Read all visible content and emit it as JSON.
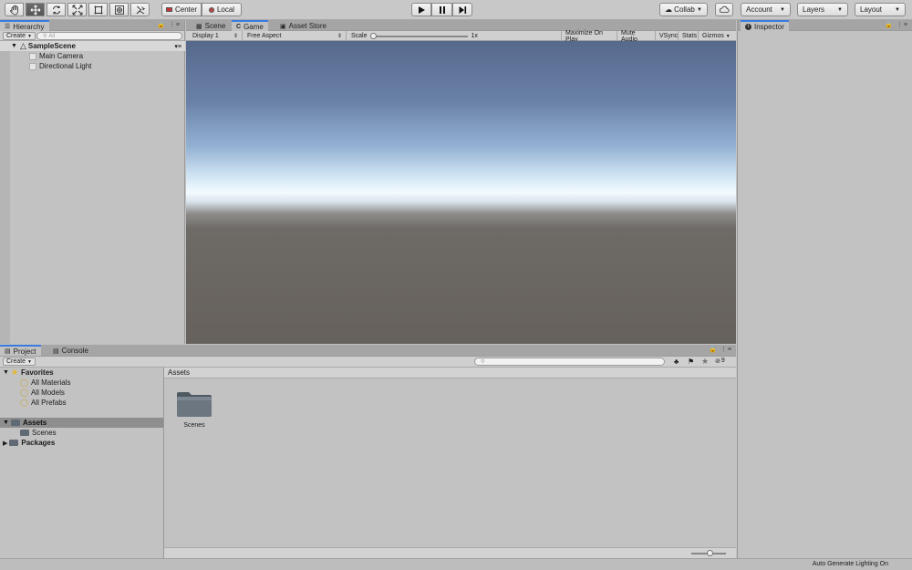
{
  "toolbar": {
    "pivot_center": "Center",
    "pivot_local": "Local",
    "collab": "Collab",
    "account": "Account",
    "layers": "Layers",
    "layout": "Layout"
  },
  "hierarchy": {
    "tab": "Hierarchy",
    "create": "Create",
    "search_placeholder": "All",
    "scene": "SampleScene",
    "items": [
      "Main Camera",
      "Directional Light"
    ]
  },
  "center_tabs": {
    "scene": "Scene",
    "game": "Game",
    "asset_store": "Asset Store"
  },
  "game_bar": {
    "display": "Display 1",
    "aspect": "Free Aspect",
    "scale_label": "Scale",
    "scale_value": "1x",
    "maximize": "Maximize On Play",
    "mute": "Mute Audio",
    "vsync": "VSync",
    "stats": "Stats",
    "gizmos": "Gizmos"
  },
  "inspector": {
    "tab": "Inspector"
  },
  "project": {
    "tab": "Project",
    "console_tab": "Console",
    "create": "Create",
    "hidden_count": "9",
    "favorites": "Favorites",
    "favorite_items": [
      "All Materials",
      "All Models",
      "All Prefabs"
    ],
    "assets": "Assets",
    "scenes_sub": "Scenes",
    "packages": "Packages",
    "breadcrumb": "Assets",
    "folder_label": "Scenes",
    "zoom_level": 0.55
  },
  "status": {
    "text": "Auto Generate Lighting On"
  },
  "colors": {
    "accent": "#3a7be0",
    "selection": "#8e8e8e",
    "folder": "#5f6a74"
  }
}
